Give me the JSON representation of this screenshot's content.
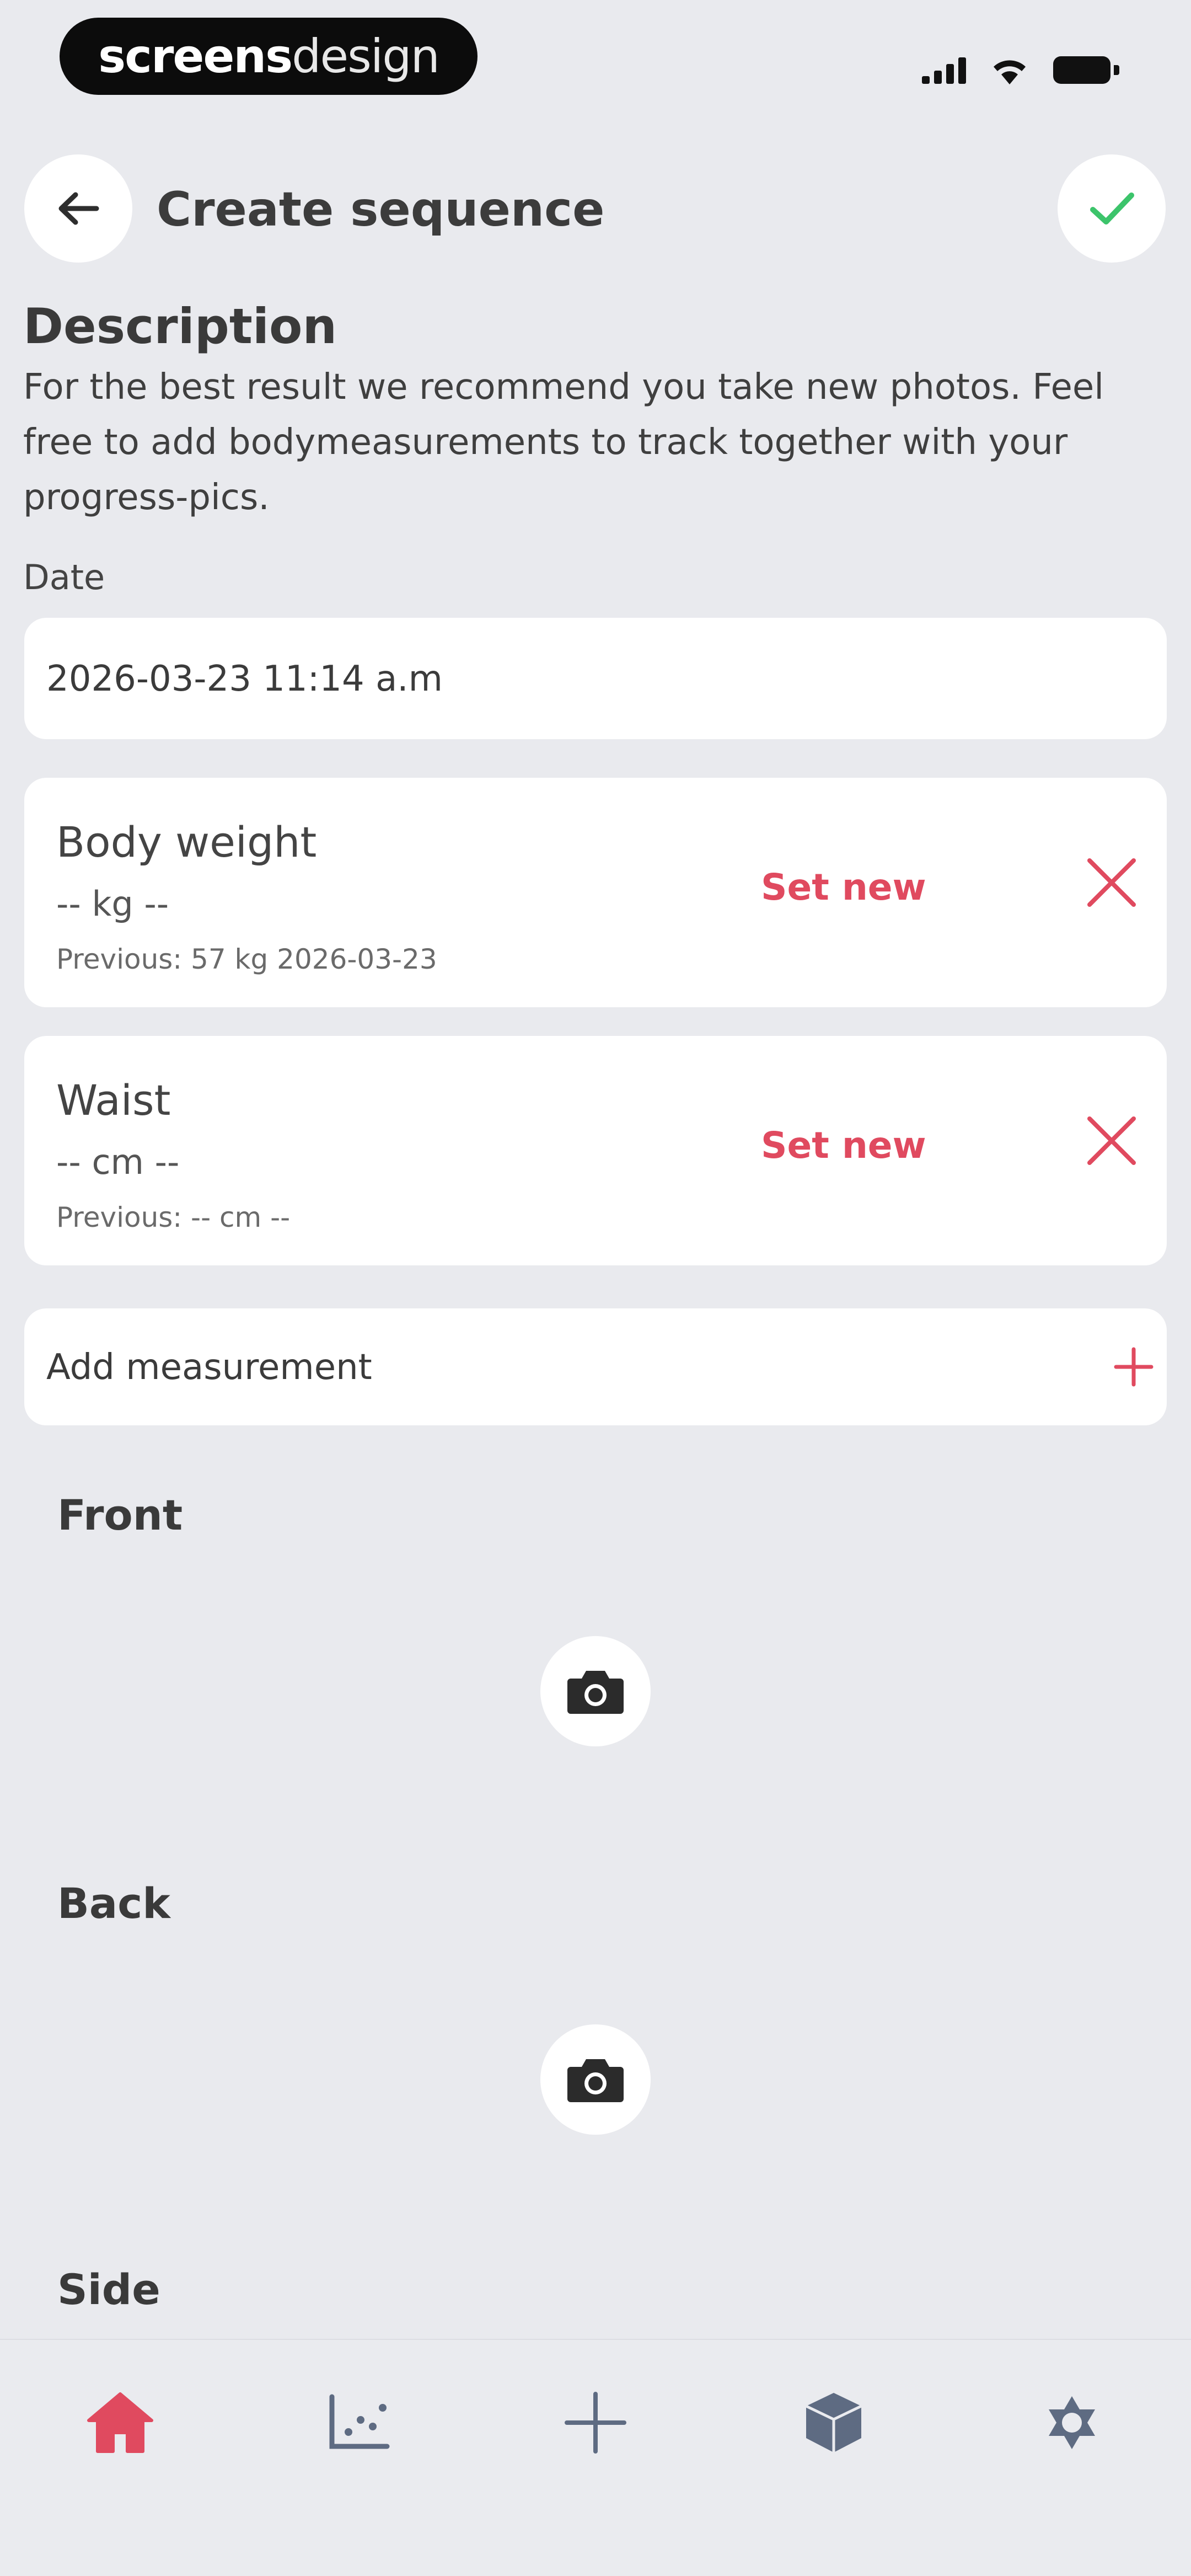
{
  "status_bar": {
    "brand_bold": "screens",
    "brand_light": "design"
  },
  "header": {
    "title": "Create sequence"
  },
  "description": {
    "heading": "Description",
    "text": "For the best result we recommend you take new photos. Feel free to add bodymeasurements to track together with your progress-pics."
  },
  "date": {
    "label": "Date",
    "value": "2026-03-23 11:14 a.m"
  },
  "measurements": [
    {
      "title": "Body weight",
      "value": "-- kg  --",
      "previous": "Previous: 57 kg 2026-03-23",
      "action": "Set new"
    },
    {
      "title": "Waist",
      "value": "-- cm  --",
      "previous": "Previous: -- cm --",
      "action": "Set new"
    }
  ],
  "add_measurement": {
    "label": "Add measurement"
  },
  "photos": [
    {
      "label": "Front"
    },
    {
      "label": "Back"
    },
    {
      "label": "Side"
    }
  ],
  "tab_bar": {
    "items": [
      {
        "icon": "home-icon",
        "active": true
      },
      {
        "icon": "chart-icon",
        "active": false
      },
      {
        "icon": "plus-icon",
        "active": false
      },
      {
        "icon": "cube-icon",
        "active": false
      },
      {
        "icon": "settings-icon",
        "active": false
      }
    ]
  },
  "colors": {
    "accent": "#E04A5F",
    "success": "#3CC46B",
    "background": "#E9EAEE",
    "card": "#FFFFFF",
    "inactive_icon": "#5E6B82"
  }
}
